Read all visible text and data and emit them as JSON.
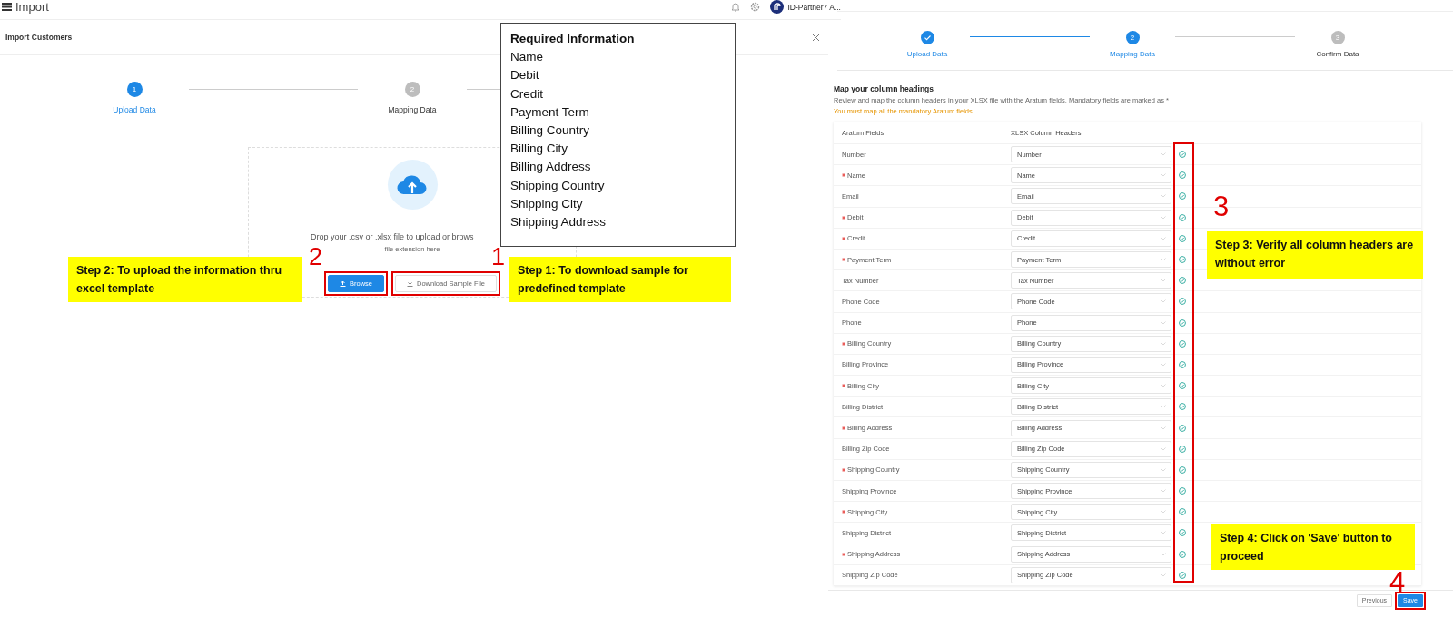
{
  "upload_screen": {
    "app_title": "Import",
    "user_name": "ID-Partner7 A...",
    "dialog_title": "Import Customers",
    "steps": [
      {
        "number": "1",
        "label": "Upload Data",
        "completed": false,
        "current": true
      },
      {
        "number": "2",
        "label": "Mapping Data",
        "completed": false,
        "current": false
      }
    ],
    "drop_text": "Drop your .csv or .xlsx file to upload or brows",
    "drop_hint": "file extension here",
    "buttons": [
      {
        "kind": "primary",
        "label": "Browse",
        "highlighted": true
      },
      {
        "kind": "secondary",
        "label": "Download Sample File",
        "highlighted": true
      }
    ]
  },
  "mapping_screen": {
    "steps": [
      {
        "label": "Upload Data",
        "completed": true
      },
      {
        "number": "2",
        "label": "Mapping Data",
        "completed": false,
        "current": true
      },
      {
        "number": "3",
        "label": "Confirm Data",
        "completed": false,
        "current": false
      }
    ],
    "heading": "Map your column headings",
    "description": "Review and map the column headers in your XLSX file with the Aratum fields. Mandatory fields are marked as *",
    "warning": "You must map all the mandatory Aratum fields.",
    "columns": [
      "Aratum Fields",
      "XLSX Column Headers"
    ],
    "rows": [
      {
        "field": "Number",
        "required": false,
        "value": "Number"
      },
      {
        "field": "Name",
        "required": true,
        "value": "Name"
      },
      {
        "field": "Email",
        "required": false,
        "value": "Email"
      },
      {
        "field": "Debit",
        "required": true,
        "value": "Debit"
      },
      {
        "field": "Credit",
        "required": true,
        "value": "Credit"
      },
      {
        "field": "Payment Term",
        "required": true,
        "value": "Payment Term"
      },
      {
        "field": "Tax Number",
        "required": false,
        "value": "Tax Number"
      },
      {
        "field": "Phone Code",
        "required": false,
        "value": "Phone Code"
      },
      {
        "field": "Phone",
        "required": false,
        "value": "Phone"
      },
      {
        "field": "Billing Country",
        "required": true,
        "value": "Billing Country"
      },
      {
        "field": "Billing Province",
        "required": false,
        "value": "Billing Province"
      },
      {
        "field": "Billing City",
        "required": true,
        "value": "Billing City"
      },
      {
        "field": "Billing District",
        "required": false,
        "value": "Billing District"
      },
      {
        "field": "Billing Address",
        "required": true,
        "value": "Billing Address"
      },
      {
        "field": "Billing Zip Code",
        "required": false,
        "value": "Billing Zip Code"
      },
      {
        "field": "Shipping Country",
        "required": true,
        "value": "Shipping Country"
      },
      {
        "field": "Shipping Province",
        "required": false,
        "value": "Shipping Province"
      },
      {
        "field": "Shipping City",
        "required": true,
        "value": "Shipping City"
      },
      {
        "field": "Shipping District",
        "required": false,
        "value": "Shipping District"
      },
      {
        "field": "Shipping Address",
        "required": true,
        "value": "Shipping Address"
      },
      {
        "field": "Shipping Zip Code",
        "required": false,
        "value": "Shipping Zip Code"
      }
    ],
    "buttons": [
      {
        "kind": "secondary",
        "label": "Previous",
        "highlighted": false
      },
      {
        "kind": "primary",
        "label": "Save",
        "highlighted": true
      }
    ]
  },
  "required_info": {
    "title": "Required Information",
    "items": [
      "Name",
      "Debit",
      "Credit",
      "Payment Term",
      "Billing Country",
      "Billing City",
      "Billing Address",
      "Shipping Country",
      "Shipping City",
      "Shipping Address"
    ]
  },
  "callouts": [
    "Step 2: To upload the information thru excel template",
    "Step 1: To download sample for predefined template",
    "Step 3: Verify all column headers are without error",
    "Step 4: Click on 'Save' button to proceed"
  ],
  "step_numbers": [
    "2",
    "1",
    "3",
    "4"
  ]
}
